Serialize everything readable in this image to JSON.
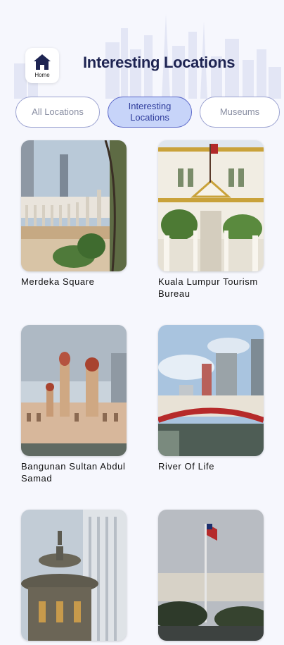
{
  "header": {
    "home_label": "Home",
    "title": "Interesting Locations"
  },
  "tabs": [
    {
      "label": "All Locations",
      "active": false
    },
    {
      "label": "Interesting Locations",
      "active": true
    },
    {
      "label": "Museums",
      "active": false
    }
  ],
  "locations": [
    {
      "name": "Merdeka Square"
    },
    {
      "name": "Kuala Lumpur Tourism Bureau"
    },
    {
      "name": "Bangunan Sultan Abdul Samad"
    },
    {
      "name": "River Of Life"
    },
    {
      "name": ""
    },
    {
      "name": ""
    }
  ],
  "colors": {
    "background": "#f6f7fd",
    "title": "#1e2452",
    "active_tab_bg": "#c7d4f9",
    "active_tab_border": "#5a67c9",
    "inactive_tab_text": "#8a8fa3"
  }
}
